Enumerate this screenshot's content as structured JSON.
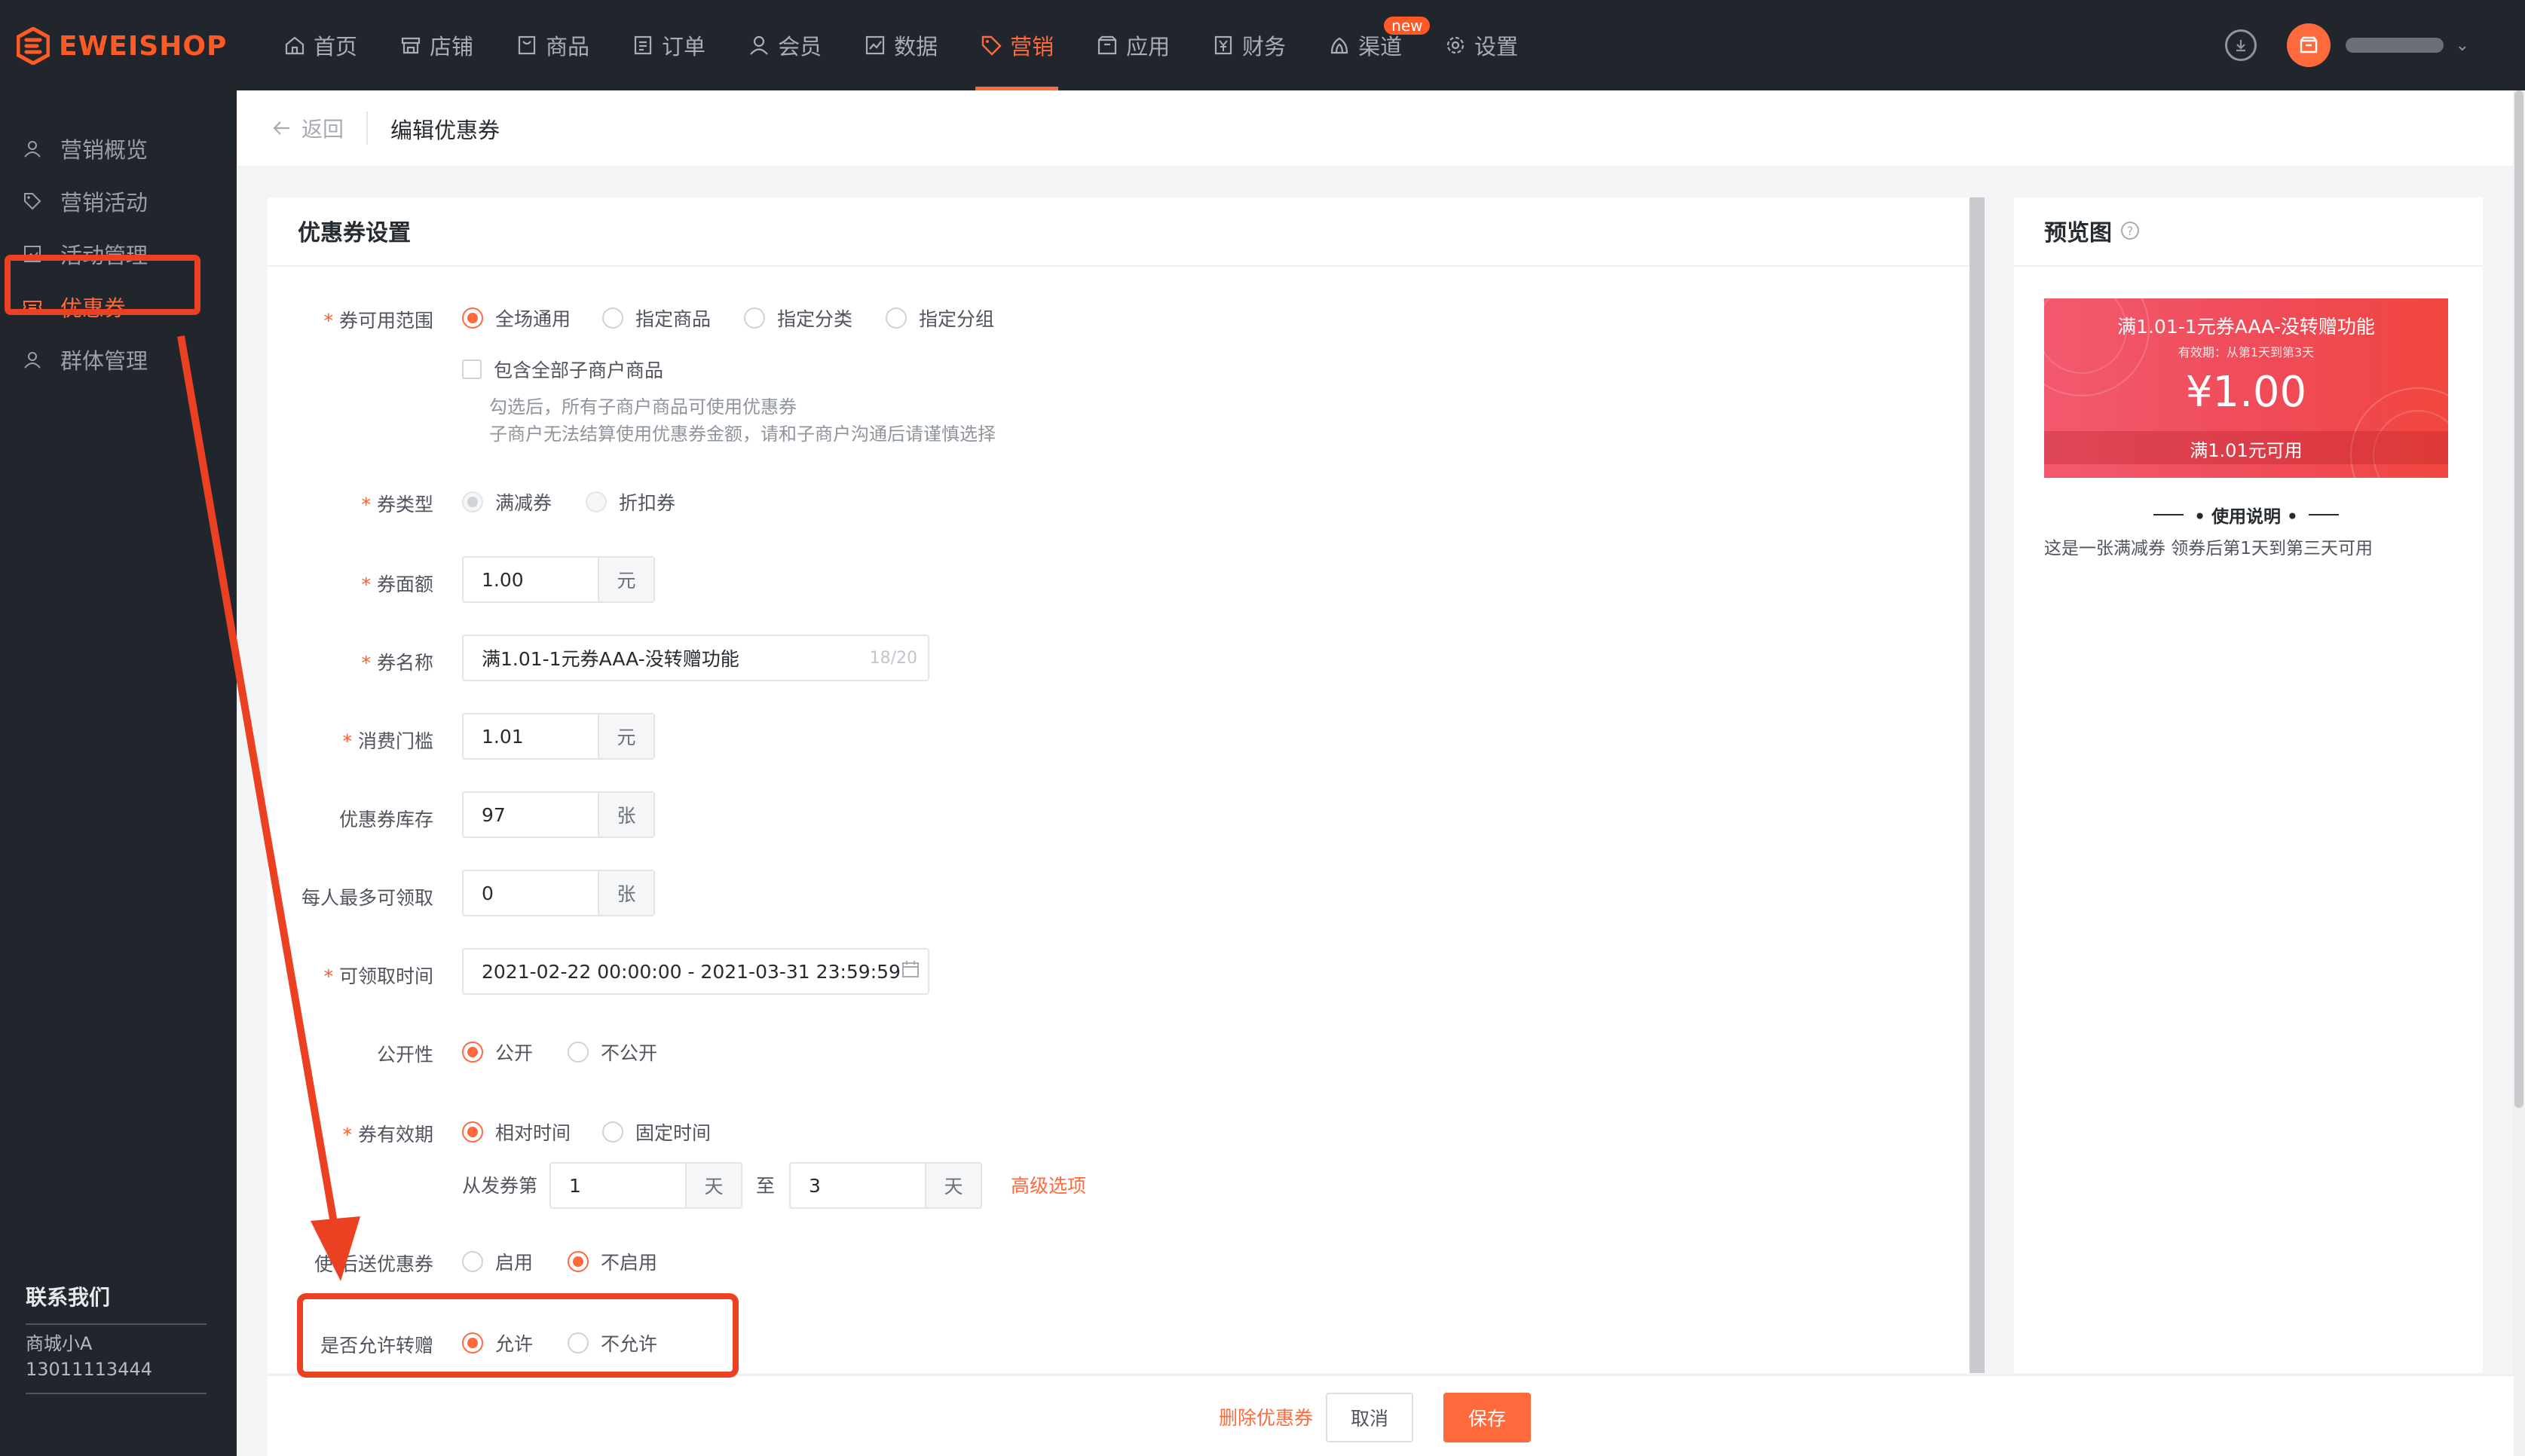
{
  "app": {
    "logo_text": "EWEISHOP"
  },
  "nav": {
    "items": [
      {
        "label": "首页",
        "icon": "home-icon"
      },
      {
        "label": "店铺",
        "icon": "store-icon"
      },
      {
        "label": "商品",
        "icon": "goods-icon"
      },
      {
        "label": "订单",
        "icon": "order-icon"
      },
      {
        "label": "会员",
        "icon": "member-icon"
      },
      {
        "label": "数据",
        "icon": "chart-icon"
      },
      {
        "label": "营销",
        "icon": "tag-icon",
        "active": true
      },
      {
        "label": "应用",
        "icon": "app-icon"
      },
      {
        "label": "财务",
        "icon": "finance-icon"
      },
      {
        "label": "渠道",
        "icon": "channel-icon",
        "badge": "new"
      },
      {
        "label": "设置",
        "icon": "gear-icon"
      }
    ],
    "accent": "#ff6a3d"
  },
  "sidebar": {
    "items": [
      {
        "label": "营销概览",
        "icon": "overview-icon"
      },
      {
        "label": "营销活动",
        "icon": "tag-icon"
      },
      {
        "label": "活动管理",
        "icon": "picture-icon"
      },
      {
        "label": "优惠券",
        "icon": "coupon-icon",
        "active": true
      },
      {
        "label": "群体管理",
        "icon": "group-icon"
      }
    ],
    "contact": {
      "title": "联系我们",
      "name": "商城小A",
      "phone": "13011113444"
    }
  },
  "header": {
    "back_label": "返回",
    "title": "编辑优惠券"
  },
  "form": {
    "section_title": "优惠券设置",
    "scope": {
      "label": "券可用范围",
      "options": [
        "全场通用",
        "指定商品",
        "指定分类",
        "指定分组"
      ],
      "selected": "全场通用",
      "checkbox_label": "包含全部子商户商品",
      "hint_1": "勾选后，所有子商户商品可使用优惠券",
      "hint_2": "子商户无法结算使用优惠券金额，请和子商户沟通后请谨慎选择"
    },
    "type": {
      "label": "券类型",
      "options": [
        "满减券",
        "折扣券"
      ],
      "selected": "满减券"
    },
    "amount": {
      "label": "券面额",
      "value": "1.00",
      "suffix": "元"
    },
    "name": {
      "label": "券名称",
      "value": "满1.01-1元券AAA-没转赠功能",
      "count": "18/20"
    },
    "threshold": {
      "label": "消费门槛",
      "value": "1.01",
      "suffix": "元"
    },
    "stock": {
      "label": "优惠券库存",
      "value": "97",
      "suffix": "张"
    },
    "per_user": {
      "label": "每人最多可领取",
      "value": "0",
      "suffix": "张"
    },
    "receive_time": {
      "label": "可领取时间",
      "value": "2021-02-22 00:00:00 - 2021-03-31 23:59:59"
    },
    "visibility": {
      "label": "公开性",
      "options": [
        "公开",
        "不公开"
      ],
      "selected": "公开"
    },
    "validity": {
      "label": "券有效期",
      "options": [
        "相对时间",
        "固定时间"
      ],
      "selected": "相对时间",
      "from_label": "从发券第",
      "from_value": "1",
      "from_unit": "天",
      "to_label": "至",
      "to_value": "3",
      "to_unit": "天",
      "advanced_link": "高级选项"
    },
    "after_use": {
      "label": "使用后送优惠券",
      "label_visible": "使   后送优惠券",
      "options": [
        "启用",
        "不启用"
      ],
      "selected": "不启用"
    },
    "transfer": {
      "label": "是否允许转赠",
      "options": [
        "允许",
        "不允许"
      ],
      "selected": "允许"
    }
  },
  "footer": {
    "delete_label": "删除优惠券",
    "cancel_label": "取消",
    "save_label": "保存"
  },
  "preview": {
    "title": "预览图",
    "coupon_name": "满1.01-1元券AAA-没转赠功能",
    "coupon_valid": "有效期：从第1天到第3天",
    "coupon_amount": "¥1.00",
    "coupon_condition": "满1.01元可用",
    "usage_title": "• 使用说明 •",
    "usage_desc": "这是一张满减券 领券后第1天到第三天可用"
  }
}
